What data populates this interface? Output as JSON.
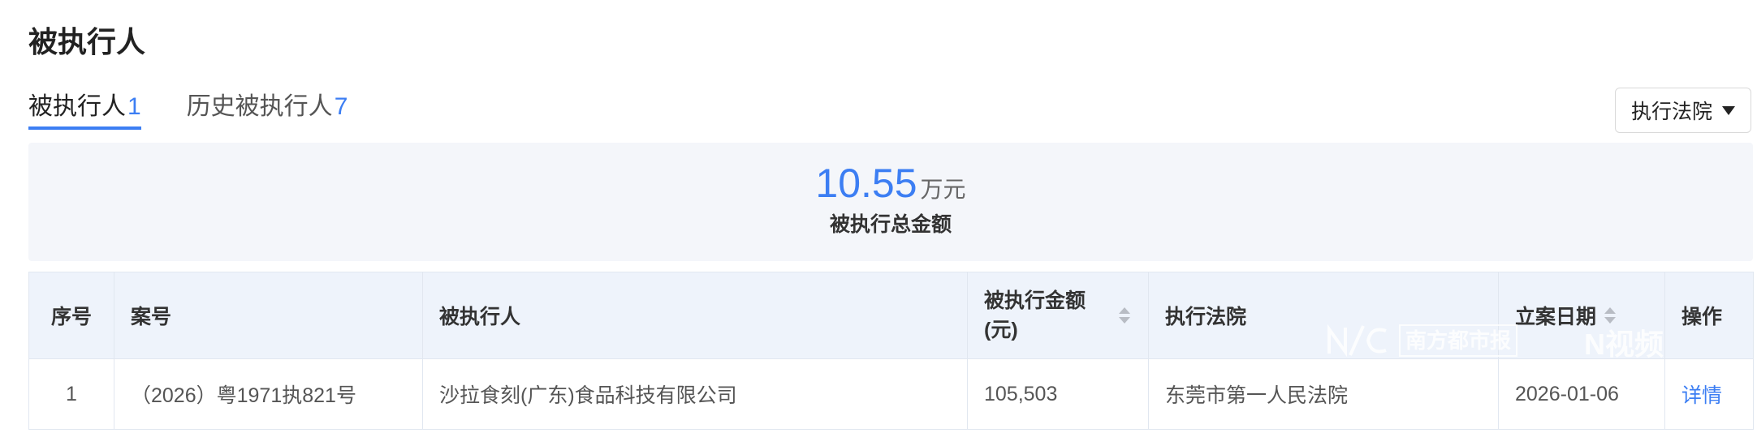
{
  "page": {
    "title": "被执行人"
  },
  "tabs": [
    {
      "label": "被执行人",
      "count": "1",
      "active": true
    },
    {
      "label": "历史被执行人",
      "count": "7",
      "active": false
    }
  ],
  "filter": {
    "label": "执行法院",
    "icon": "caret-down-icon"
  },
  "summary": {
    "amount": "10.55",
    "unit": "万元",
    "label": "被执行总金额"
  },
  "table": {
    "columns": [
      {
        "label": "序号"
      },
      {
        "label": "案号"
      },
      {
        "label": "被执行人"
      },
      {
        "label": "被执行金额",
        "sub": "(元)",
        "sortable": true
      },
      {
        "label": "执行法院"
      },
      {
        "label": "立案日期",
        "sortable": true
      },
      {
        "label": "操作"
      }
    ],
    "rows": [
      {
        "index": "1",
        "case_no": "（2026）粤1971执821号",
        "party": "沙拉食刻(广东)食品科技有限公司",
        "amount": "105,503",
        "court": "东莞市第一人民法院",
        "filed_date": "2026-01-06",
        "action": "详情"
      }
    ]
  },
  "watermarks": {
    "nandu": "南方都市报",
    "nvideo": "N视频"
  },
  "colors": {
    "accent": "#3c7ef3",
    "summary_background": "#f4f6fa",
    "table_header_background": "#eef3fb"
  }
}
